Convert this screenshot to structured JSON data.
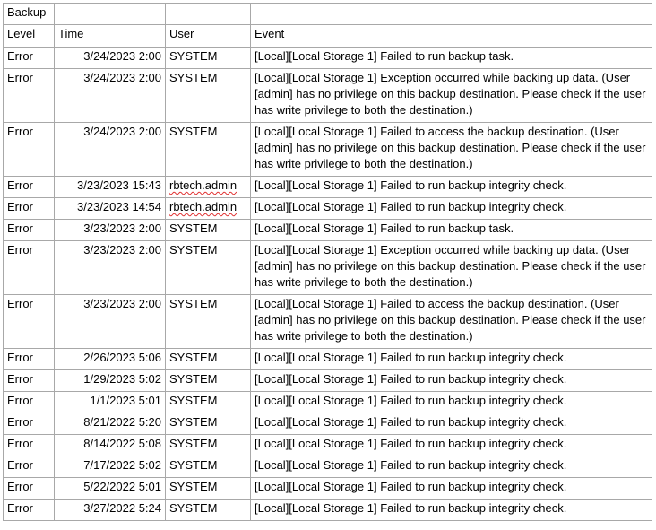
{
  "sheet": {
    "title": "Backup",
    "headers": {
      "level": "Level",
      "time": "Time",
      "user": "User",
      "event": "Event"
    },
    "rows": [
      {
        "level": "Error",
        "time": "3/24/2023 2:00",
        "user": "SYSTEM",
        "user_flagged": false,
        "lines": 1,
        "event": "[Local][Local Storage 1] Failed to run backup task."
      },
      {
        "level": "Error",
        "time": "3/24/2023 2:00",
        "user": "SYSTEM",
        "user_flagged": false,
        "lines": 3,
        "event": "[Local][Local Storage 1] Exception occurred while backing up data. (User [admin] has no privilege on this backup destination. Please check if the user has write privilege to both the destination.)"
      },
      {
        "level": "Error",
        "time": "3/24/2023 2:00",
        "user": "SYSTEM",
        "user_flagged": false,
        "lines": 3,
        "event": "[Local][Local Storage 1] Failed to access the backup destination. (User [admin] has no privilege on this backup destination. Please check if the user has write privilege to both the destination.)"
      },
      {
        "level": "Error",
        "time": "3/23/2023 15:43",
        "user": "rbtech.admin",
        "user_flagged": true,
        "lines": 1,
        "event": "[Local][Local Storage 1] Failed to run backup integrity check."
      },
      {
        "level": "Error",
        "time": "3/23/2023 14:54",
        "user": "rbtech.admin",
        "user_flagged": true,
        "lines": 1,
        "event": "[Local][Local Storage 1] Failed to run backup integrity check."
      },
      {
        "level": "Error",
        "time": "3/23/2023 2:00",
        "user": "SYSTEM",
        "user_flagged": false,
        "lines": 1,
        "event": "[Local][Local Storage 1] Failed to run backup task."
      },
      {
        "level": "Error",
        "time": "3/23/2023 2:00",
        "user": "SYSTEM",
        "user_flagged": false,
        "lines": 3,
        "event": "[Local][Local Storage 1] Exception occurred while backing up data. (User [admin] has no privilege on this backup destination. Please check if the user has write privilege to both the destination.)"
      },
      {
        "level": "Error",
        "time": "3/23/2023 2:00",
        "user": "SYSTEM",
        "user_flagged": false,
        "lines": 3,
        "event": "[Local][Local Storage 1] Failed to access the backup destination. (User [admin] has no privilege on this backup destination. Please check if the user has write privilege to both the destination.)"
      },
      {
        "level": "Error",
        "time": "2/26/2023 5:06",
        "user": "SYSTEM",
        "user_flagged": false,
        "lines": 1,
        "event": "[Local][Local Storage 1] Failed to run backup integrity check."
      },
      {
        "level": "Error",
        "time": "1/29/2023 5:02",
        "user": "SYSTEM",
        "user_flagged": false,
        "lines": 1,
        "event": "[Local][Local Storage 1] Failed to run backup integrity check."
      },
      {
        "level": "Error",
        "time": "1/1/2023 5:01",
        "user": "SYSTEM",
        "user_flagged": false,
        "lines": 1,
        "event": "[Local][Local Storage 1] Failed to run backup integrity check."
      },
      {
        "level": "Error",
        "time": "8/21/2022 5:20",
        "user": "SYSTEM",
        "user_flagged": false,
        "lines": 1,
        "event": "[Local][Local Storage 1] Failed to run backup integrity check."
      },
      {
        "level": "Error",
        "time": "8/14/2022 5:08",
        "user": "SYSTEM",
        "user_flagged": false,
        "lines": 1,
        "event": "[Local][Local Storage 1] Failed to run backup integrity check."
      },
      {
        "level": "Error",
        "time": "7/17/2022 5:02",
        "user": "SYSTEM",
        "user_flagged": false,
        "lines": 1,
        "event": "[Local][Local Storage 1] Failed to run backup integrity check."
      },
      {
        "level": "Error",
        "time": "5/22/2022 5:01",
        "user": "SYSTEM",
        "user_flagged": false,
        "lines": 1,
        "event": "[Local][Local Storage 1] Failed to run backup integrity check."
      },
      {
        "level": "Error",
        "time": "3/27/2022 5:24",
        "user": "SYSTEM",
        "user_flagged": false,
        "lines": 1,
        "event": "[Local][Local Storage 1] Failed to run backup integrity check."
      }
    ]
  }
}
